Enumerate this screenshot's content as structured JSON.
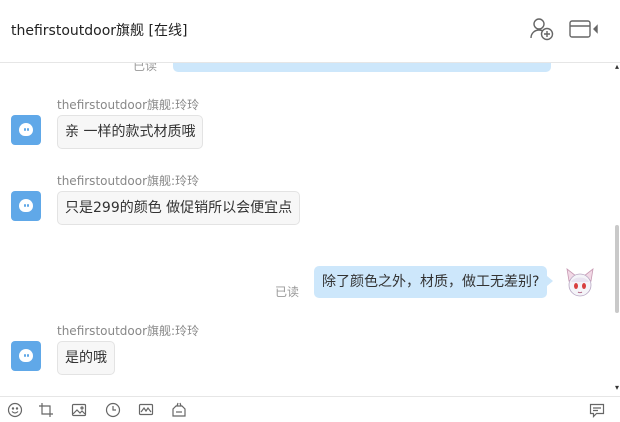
{
  "header": {
    "title": "thefirstoutdoor旗舰 [在线]",
    "icons": [
      "add-contact-icon",
      "window-panel-icon"
    ]
  },
  "chat": {
    "messages": [
      {
        "direction": "out",
        "status": "已读",
        "text": ""
      },
      {
        "direction": "in",
        "sender": "thefirstoutdoor旗舰:玲玲",
        "text": "亲 一样的款式材质哦"
      },
      {
        "direction": "in",
        "sender": "thefirstoutdoor旗舰:玲玲",
        "text": "只是299的颜色  做促销所以会便宜点"
      },
      {
        "direction": "out",
        "status": "已读",
        "text": "除了颜色之外，材质，做工无差别?"
      },
      {
        "direction": "in",
        "sender": "thefirstoutdoor旗舰:玲玲",
        "text": "是的哦"
      }
    ]
  },
  "toolbar": {
    "icons": [
      "emoji-icon",
      "screenshot-crop-icon",
      "image-icon",
      "clock-icon",
      "chart-icon",
      "coupon-icon",
      "message-icon"
    ]
  },
  "colors": {
    "accent": "#60a8e8",
    "bubble_out": "#cde7fb",
    "bubble_in": "#f7f7f7"
  }
}
